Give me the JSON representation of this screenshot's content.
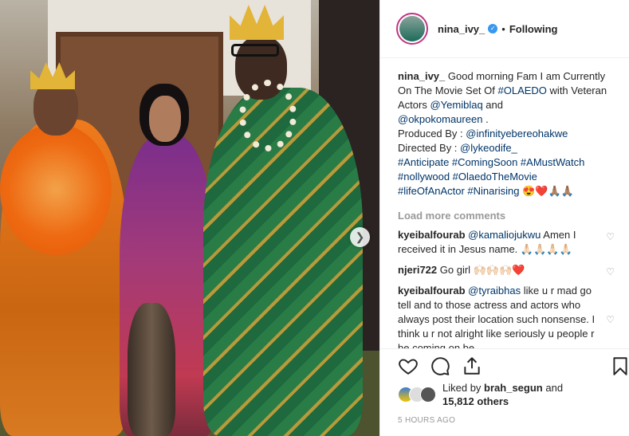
{
  "post": {
    "username": "nina_ivy_",
    "verified_icon": "verified-badge-icon",
    "separator": "•",
    "follow_state": "Following"
  },
  "caption": {
    "username": "nina_ivy_",
    "line1": "Good morning Fam I am Currently On The Movie Set Of",
    "tag_oladeo": "#OLAEDO",
    "with": "with Veteran Actors",
    "mention1": "@Yemiblaq",
    "and": "and",
    "mention2": "@okpokomaureen",
    "period": ".",
    "produced_by": "Produced By :",
    "producer": "@infinityebereohakwe",
    "directed_by": "Directed By :",
    "director": "@lykeodife_",
    "hashtags1": "#Anticipate #ComingSoon #AMustWatch",
    "hashtags2": "#nollywood #OlaedoTheMovie",
    "hashtags3": "#lifeOfAnActor #Ninarising",
    "emojis": "😍❤️🙏🏽🙏🏽"
  },
  "load_more": "Load more comments",
  "comments": [
    {
      "user": "kyeibalfourab",
      "mention": "@kamaliojukwu",
      "text": "Amen I received it in Jesus name. 🙏🏻🙏🏻🙏🏻🙏🏻"
    },
    {
      "user": "njeri722",
      "mention": "",
      "text": "Go girl 🙌🏻🙌🏻🙌🏻❤️"
    },
    {
      "user": "kyeibalfourab",
      "mention": "@tyraibhas",
      "text": "like u r mad go tell and to those actress and actors who always post their location such nonsense. I think u r not alright like seriously u people r be coming on be"
    }
  ],
  "likes": {
    "prefix": "Liked by",
    "user": "brah_segun",
    "and": "and",
    "count": "15,812 others"
  },
  "timestamp": "5 HOURS AGO",
  "icons": {
    "next": "chevron-right-icon",
    "like": "heart-icon",
    "comment": "comment-icon",
    "share": "share-icon",
    "save": "bookmark-icon"
  },
  "colors": {
    "link": "#003569",
    "avatar_ring": "#c13584",
    "verified": "#3897f0"
  }
}
